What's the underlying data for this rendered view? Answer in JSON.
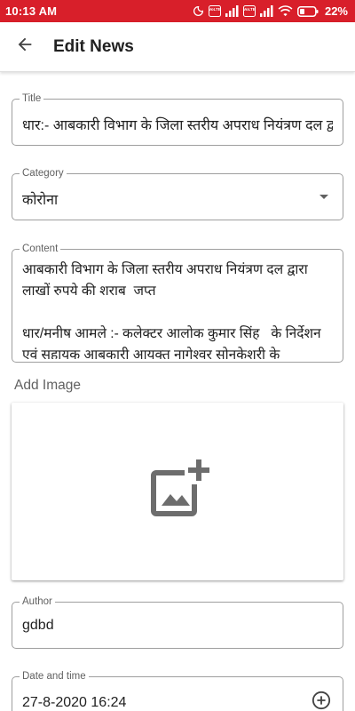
{
  "status_bar": {
    "time": "10:13 AM",
    "battery_percent": "22%",
    "volte_badge_1": "VoLTE",
    "volte_badge_2": "VoLTE",
    "background_color": "#d81f2a",
    "icons": [
      "moon-icon",
      "volte-icon",
      "signal-icon",
      "volte-icon",
      "signal-icon",
      "wifi-icon",
      "battery-icon"
    ]
  },
  "app_bar": {
    "title": "Edit News",
    "back_icon": "arrow-back-icon"
  },
  "form": {
    "title": {
      "label": "Title",
      "value": "धार:- आबकारी विभाग के जिला स्तरीय अपराध नियंत्रण दल द्वारा"
    },
    "category": {
      "label": "Category",
      "value": "कोरोना",
      "icon": "dropdown-arrow-icon"
    },
    "content": {
      "label": "Content",
      "value": "आबकारी विभाग के जिला स्तरीय अपराध नियंत्रण दल द्वारा लाखों रुपये की शराब  जप्त\n\nधार/मनीष आमले :- कलेक्टर आलोक कुमार सिंह   के निर्देशन एवं सहायक आबकारी आयुक्त नागेश्वर सोनकेशरी के"
    },
    "add_image": {
      "label": "Add Image",
      "icon": "add-photo-icon"
    },
    "author": {
      "label": "Author",
      "value": "gdbd"
    },
    "date_time": {
      "label": "Date and time",
      "value": "27-8-2020 16:24",
      "icon": "add-circle-icon"
    }
  }
}
